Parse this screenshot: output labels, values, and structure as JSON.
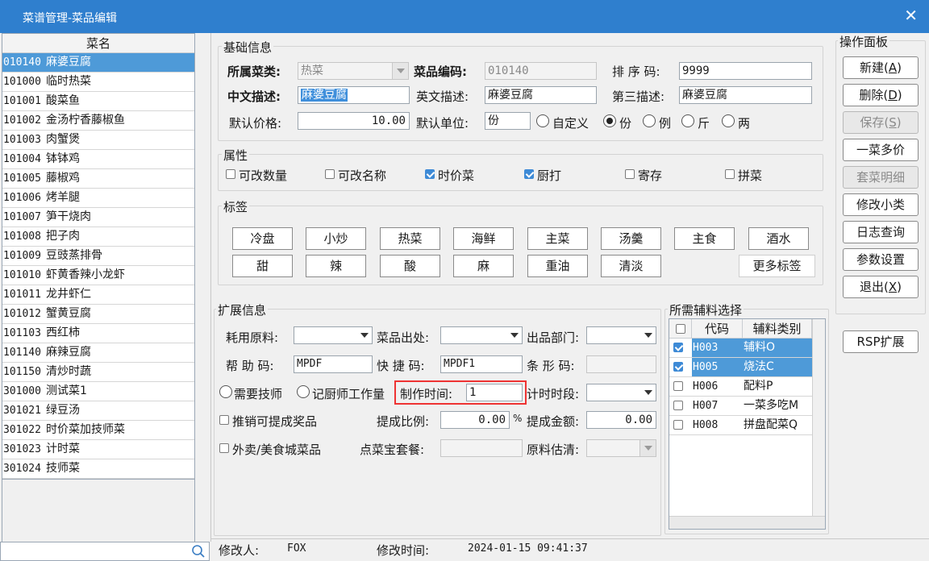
{
  "window": {
    "title": "菜谱管理-菜品编辑",
    "close_glyph": "✕"
  },
  "dish_list": {
    "header": "菜名",
    "rows": [
      {
        "code": "010140",
        "name": "麻婆豆腐"
      },
      {
        "code": "101000",
        "name": "临时热菜"
      },
      {
        "code": "101001",
        "name": "酸菜鱼"
      },
      {
        "code": "101002",
        "name": "金汤柠香藤椒鱼"
      },
      {
        "code": "101003",
        "name": "肉蟹煲"
      },
      {
        "code": "101004",
        "name": "钵钵鸡"
      },
      {
        "code": "101005",
        "name": "藤椒鸡"
      },
      {
        "code": "101006",
        "name": "烤羊腿"
      },
      {
        "code": "101007",
        "name": "笋干烧肉"
      },
      {
        "code": "101008",
        "name": "把子肉"
      },
      {
        "code": "101009",
        "name": "豆豉蒸排骨"
      },
      {
        "code": "101010",
        "name": "虾黄香辣小龙虾"
      },
      {
        "code": "101011",
        "name": "龙井虾仁"
      },
      {
        "code": "101012",
        "name": "蟹黄豆腐"
      },
      {
        "code": "101103",
        "name": "西红柿"
      },
      {
        "code": "101140",
        "name": "麻辣豆腐"
      },
      {
        "code": "101150",
        "name": "清炒时蔬"
      },
      {
        "code": "301000",
        "name": "测试菜1"
      },
      {
        "code": "301021",
        "name": "绿豆汤"
      },
      {
        "code": "301022",
        "name": "时价菜加技师菜"
      },
      {
        "code": "301023",
        "name": "计时菜"
      },
      {
        "code": "301024",
        "name": "技师菜"
      }
    ],
    "selected_index": 0,
    "search_value": ""
  },
  "basic": {
    "group_title": "基础信息",
    "category_label": "所属菜类:",
    "category_value": "热菜",
    "code_label": "菜品编码:",
    "code_value": "010140",
    "sort_label": "排 序 码:",
    "sort_value": "9999",
    "cn_label": "中文描述:",
    "cn_value": "麻婆豆腐",
    "en_label": "英文描述:",
    "en_value": "麻婆豆腐",
    "third_label": "第三描述:",
    "third_value": "麻婆豆腐",
    "price_label": "默认价格:",
    "price_value": "10.00",
    "unit_label": "默认单位:",
    "unit_value": "份",
    "unit_options": [
      "自定义",
      "份",
      "例",
      "斤",
      "两"
    ],
    "unit_selected": 1
  },
  "attrs": {
    "group_title": "属性",
    "items": [
      {
        "label": "可改数量",
        "checked": false
      },
      {
        "label": "可改名称",
        "checked": false
      },
      {
        "label": "时价菜",
        "checked": true
      },
      {
        "label": "厨打",
        "checked": true
      },
      {
        "label": "寄存",
        "checked": false
      },
      {
        "label": "拼菜",
        "checked": false
      }
    ]
  },
  "tags": {
    "group_title": "标签",
    "row1": [
      "冷盘",
      "小炒",
      "热菜",
      "海鲜",
      "主菜",
      "汤羹",
      "主食",
      "酒水"
    ],
    "row2": [
      "甜",
      "辣",
      "酸",
      "麻",
      "重油",
      "清淡"
    ],
    "more": "更多标签"
  },
  "ext": {
    "group_title": "扩展信息",
    "material_label": "耗用原料:",
    "material_value": "",
    "origin_label": "菜品出处:",
    "origin_value": "",
    "dept_label": "出品部门:",
    "dept_value": "",
    "help_label": "帮 助 码:",
    "help_value": "MPDF",
    "quick_label": "快 捷 码:",
    "quick_value": "MPDF1",
    "barcode_label": "条 形 码:",
    "barcode_value": "",
    "need_tech_label": "需要技师",
    "chef_label": "记厨师工作量",
    "make_time_label": "制作时间:",
    "make_time_value": "1",
    "time_period_label": "计时时段:",
    "time_period_value": "",
    "promo_label": "推销可提成奖品",
    "ratio_label": "提成比例:",
    "ratio_value": "0.00",
    "ratio_unit": "%",
    "amount_label": "提成金额:",
    "amount_value": "0.00",
    "takeout_label": "外卖/美食城菜品",
    "package_label": "点菜宝套餐:",
    "package_value": "",
    "estimate_label": "原料估清:",
    "estimate_value": ""
  },
  "aux": {
    "group_title": "所需辅料选择",
    "col_code": "代码",
    "col_type": "辅料类别",
    "rows": [
      {
        "checked": true,
        "code": "H003",
        "type": "辅料O",
        "selected": true
      },
      {
        "checked": true,
        "code": "H005",
        "type": "烧法C",
        "selected": true
      },
      {
        "checked": false,
        "code": "H006",
        "type": "配料P",
        "selected": false
      },
      {
        "checked": false,
        "code": "H007",
        "type": "一菜多吃M",
        "selected": false
      },
      {
        "checked": false,
        "code": "H008",
        "type": "拼盘配菜Q",
        "selected": false
      }
    ]
  },
  "ops": {
    "group_title": "操作面板",
    "new": "新建",
    "new_key": "A",
    "delete": "删除",
    "delete_key": "D",
    "save": "保存",
    "save_key": "S",
    "multi": "一菜多价",
    "set_detail": "套菜明细",
    "edit_sub": "修改小类",
    "log": "日志查询",
    "params": "参数设置",
    "exit": "退出",
    "exit_key": "X",
    "rsp": "RSP扩展"
  },
  "status": {
    "modifier_label": "修改人:",
    "modifier_value": "FOX",
    "time_label": "修改时间:",
    "time_value": "2024-01-15 09:41:37"
  }
}
